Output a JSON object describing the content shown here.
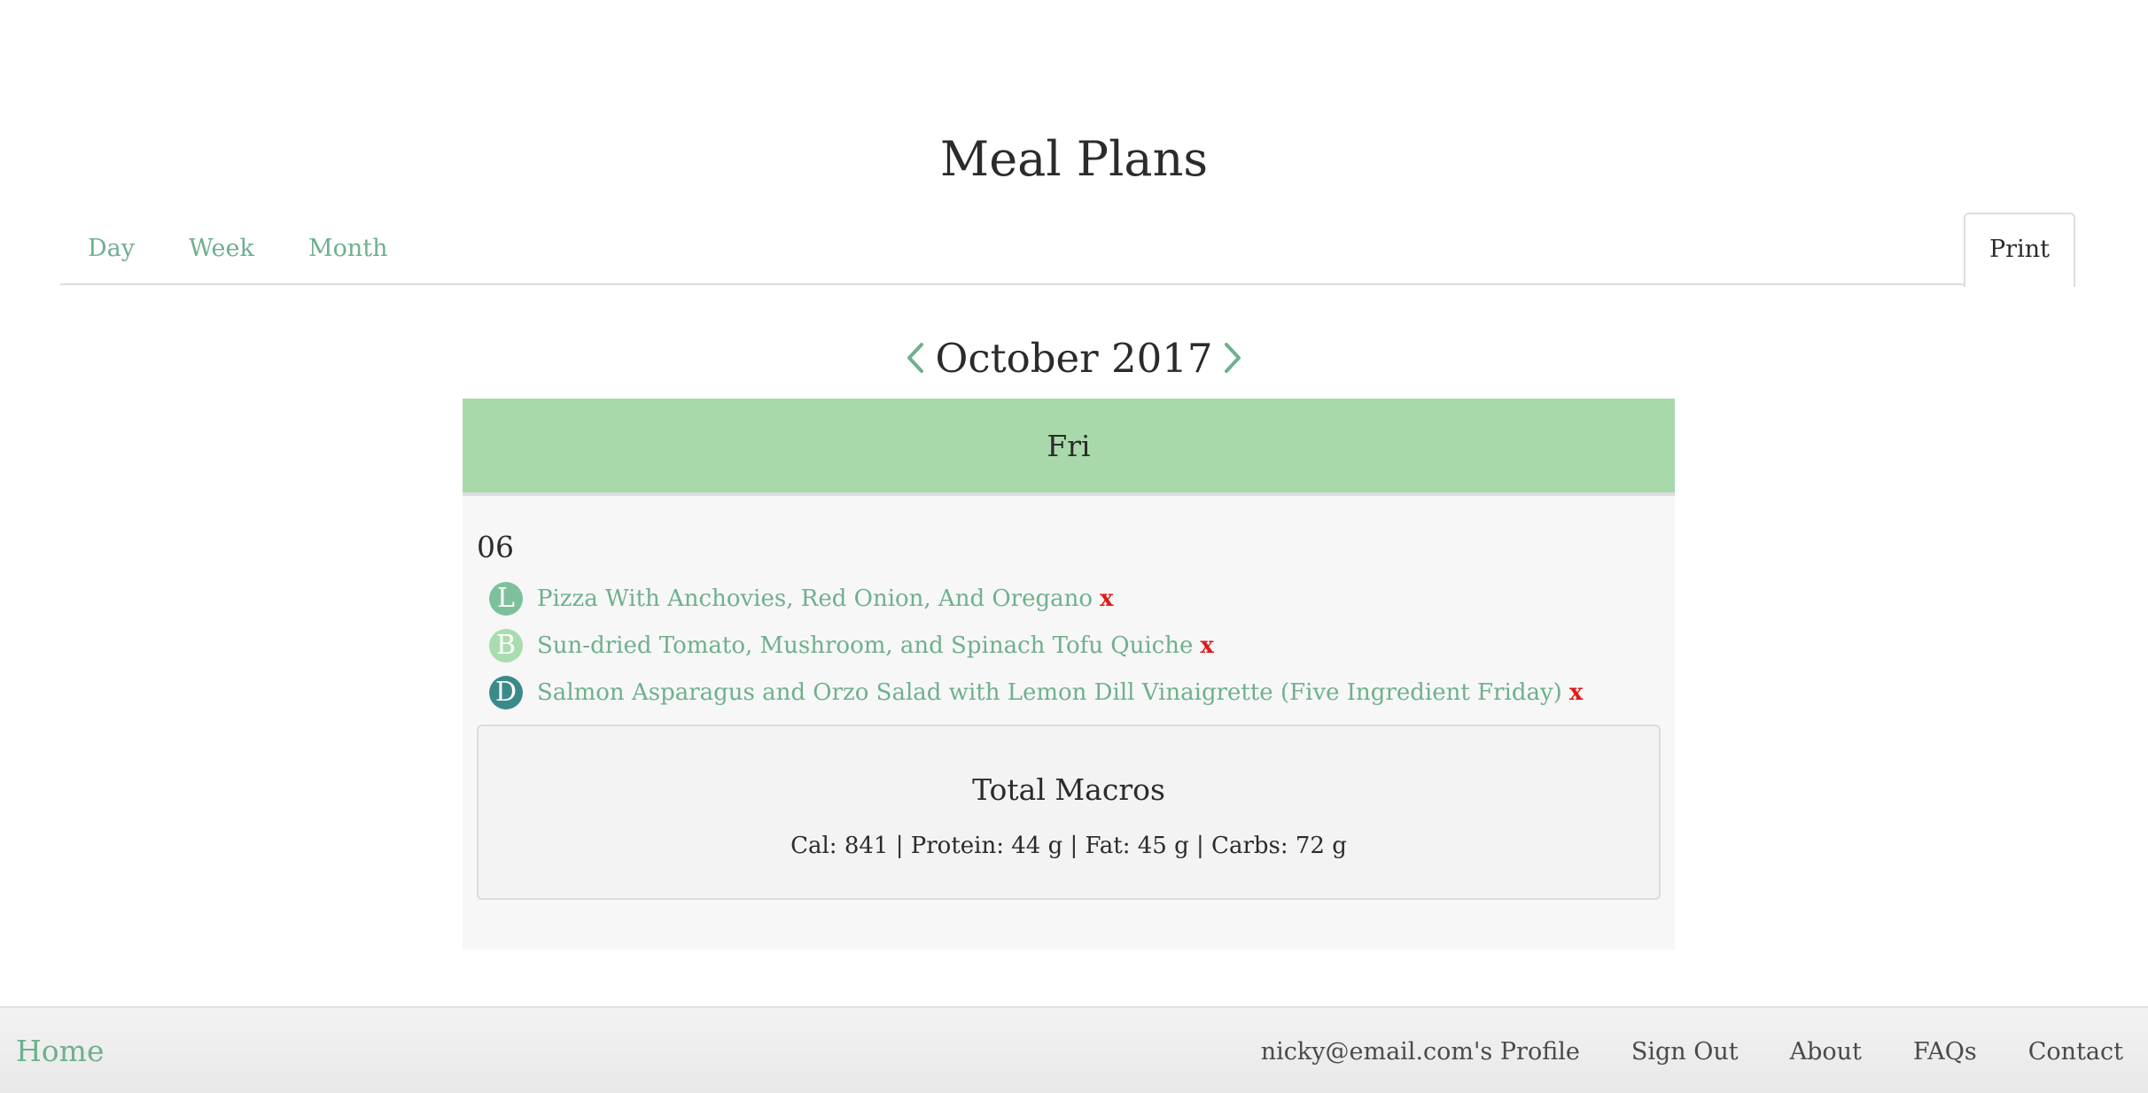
{
  "page": {
    "title": "Meal Plans"
  },
  "tabs": {
    "day": "Day",
    "week": "Week",
    "month": "Month",
    "print": "Print"
  },
  "calendar": {
    "month_label": "October 2017",
    "day_name": "Fri",
    "day_number": "06",
    "meals": [
      {
        "badge": "L",
        "badge_color": "#7ec09b",
        "name": "Pizza With Anchovies, Red Onion, And Oregano",
        "remove": "x"
      },
      {
        "badge": "B",
        "badge_color": "#a9dcae",
        "name": "Sun-dried Tomato, Mushroom, and Spinach Tofu Quiche",
        "remove": "x"
      },
      {
        "badge": "D",
        "badge_color": "#3b8a8a",
        "name": "Salmon Asparagus and Orzo Salad with Lemon Dill Vinaigrette (Five Ingredient Friday)",
        "remove": "x"
      }
    ],
    "macros": {
      "title": "Total Macros",
      "values": "Cal: 841 | Protein: 44 g | Fat: 45 g | Carbs: 72 g"
    }
  },
  "footer": {
    "home": "Home",
    "links": [
      "nicky@email.com's Profile",
      "Sign Out",
      "About",
      "FAQs",
      "Contact"
    ]
  },
  "icons": {
    "prev": "chevron-left-icon",
    "next": "chevron-right-icon"
  },
  "colors": {
    "accent": "#6fb08d",
    "header_green": "#a9d9aa",
    "remove_red": "#e01b1b"
  }
}
